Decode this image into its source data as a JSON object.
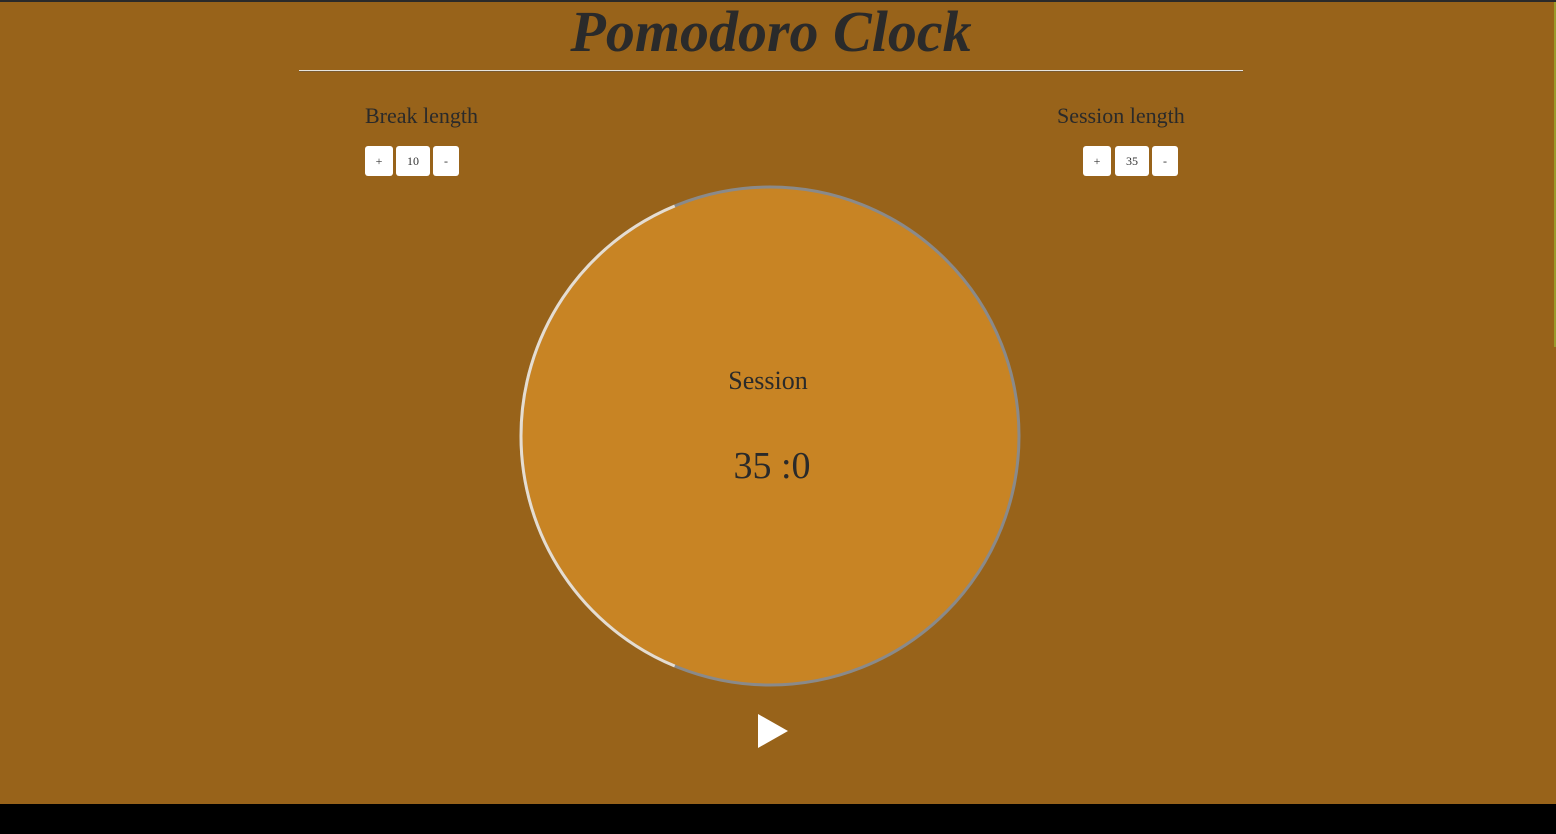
{
  "app": {
    "title": "Pomodoro Clock"
  },
  "break_setting": {
    "label": "Break length",
    "increment_label": "+",
    "value": "10",
    "decrement_label": "-"
  },
  "session_setting": {
    "label": "Session length",
    "increment_label": "+",
    "value": "35",
    "decrement_label": "-"
  },
  "timer": {
    "mode_label": "Session",
    "time_display": "35 :0",
    "progress_fraction": 0.375
  },
  "controls": {
    "play_icon": "play-icon"
  },
  "colors": {
    "background": "#98631a",
    "dial_fill": "#c88424",
    "ring_elapsed": "#e6ddd0",
    "ring_remaining": "#8a8a8a",
    "text": "#2a2a2a"
  }
}
